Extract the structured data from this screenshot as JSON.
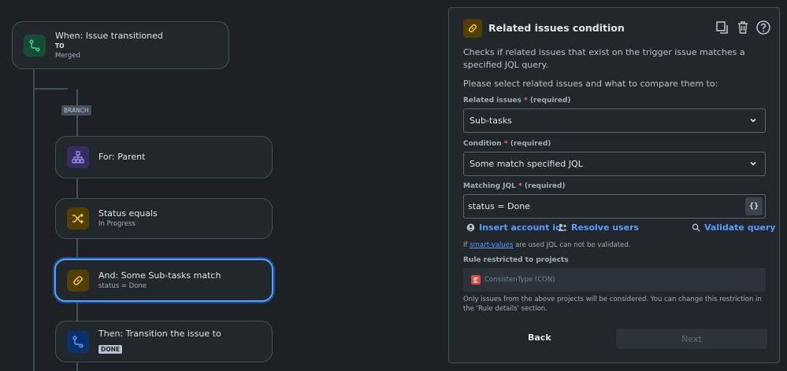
{
  "canvas": {
    "trigger": {
      "title": "When: Issue transitioned",
      "to_label": "TO",
      "target": "Merged"
    },
    "branch_label": "BRANCH",
    "for_node": {
      "title": "For: Parent"
    },
    "status_node": {
      "title": "Status equals",
      "sub": "In Progress"
    },
    "and_node": {
      "title": "And: Some Sub-tasks match",
      "sub": "status = Done"
    },
    "then_node": {
      "title": "Then: Transition the issue to",
      "badge": "DONE"
    }
  },
  "panel": {
    "title": "Related issues condition",
    "actions": [
      "copy-icon",
      "trash-icon",
      "help-icon"
    ],
    "description": "Checks if related issues that exist on the trigger issue matches a specified JQL query.",
    "prompt": "Please select related issues and what to compare them to:",
    "related_issues": {
      "label": "Related issues",
      "required": "(required)",
      "value": "Sub-tasks"
    },
    "condition": {
      "label": "Condition",
      "required": "(required)",
      "value": "Some match specified JQL"
    },
    "matching_jql": {
      "label": "Matching JQL",
      "required": "(required)",
      "value": "status = Done",
      "button": "{}"
    },
    "links": {
      "insert_account": "Insert account id",
      "resolve_users": "Resolve users",
      "validate": "Validate query"
    },
    "note_prefix": "If",
    "note_link": "smart-values",
    "note_suffix": "are used JQL can not be validated.",
    "restricted_label": "Rule restricted to projects",
    "project": "ConsistenType (CON)",
    "restriction_note": "Only issues from the above projects will be considered. You can change this restriction in the 'Rule details' section.",
    "back": "Back",
    "next": "Next"
  },
  "colors": {
    "accent": "#579dff",
    "background": "#1d2125",
    "required": "#f87168"
  }
}
